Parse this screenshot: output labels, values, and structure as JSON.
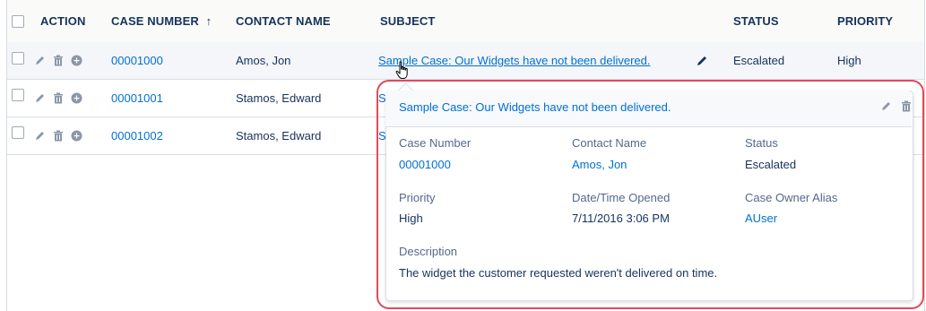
{
  "columns": {
    "action": "ACTION",
    "case_number": "CASE NUMBER",
    "sort_icon": "↑",
    "contact_name": "CONTACT NAME",
    "subject": "SUBJECT",
    "status": "STATUS",
    "priority": "PRIORITY"
  },
  "rows": [
    {
      "case_number": "00001000",
      "contact_name": "Amos, Jon",
      "subject": "Sample Case: Our Widgets have not been delivered.",
      "status": "Escalated",
      "priority": "High"
    },
    {
      "case_number": "00001001",
      "contact_name": "Stamos, Edward",
      "subject": "S"
    },
    {
      "case_number": "00001002",
      "contact_name": "Stamos, Edward",
      "subject": "S"
    }
  ],
  "popover": {
    "title": "Sample Case: Our Widgets have not been delivered.",
    "fields": {
      "case_number_label": "Case Number",
      "case_number_value": "00001000",
      "contact_name_label": "Contact Name",
      "contact_name_value": "Amos, Jon",
      "status_label": "Status",
      "status_value": "Escalated",
      "priority_label": "Priority",
      "priority_value": "High",
      "date_opened_label": "Date/Time Opened",
      "date_opened_value": "7/11/2016 3:06 PM",
      "owner_alias_label": "Case Owner Alias",
      "owner_alias_value": "AUser",
      "description_label": "Description",
      "description_value": "The widget the customer requested weren't delivered on time."
    }
  },
  "colors": {
    "link": "#0070d2",
    "text": "#16325c",
    "label": "#54698d",
    "highlight_outline": "#e4485a",
    "icon_gray": "#8a97a8",
    "border": "#d8dde6"
  }
}
